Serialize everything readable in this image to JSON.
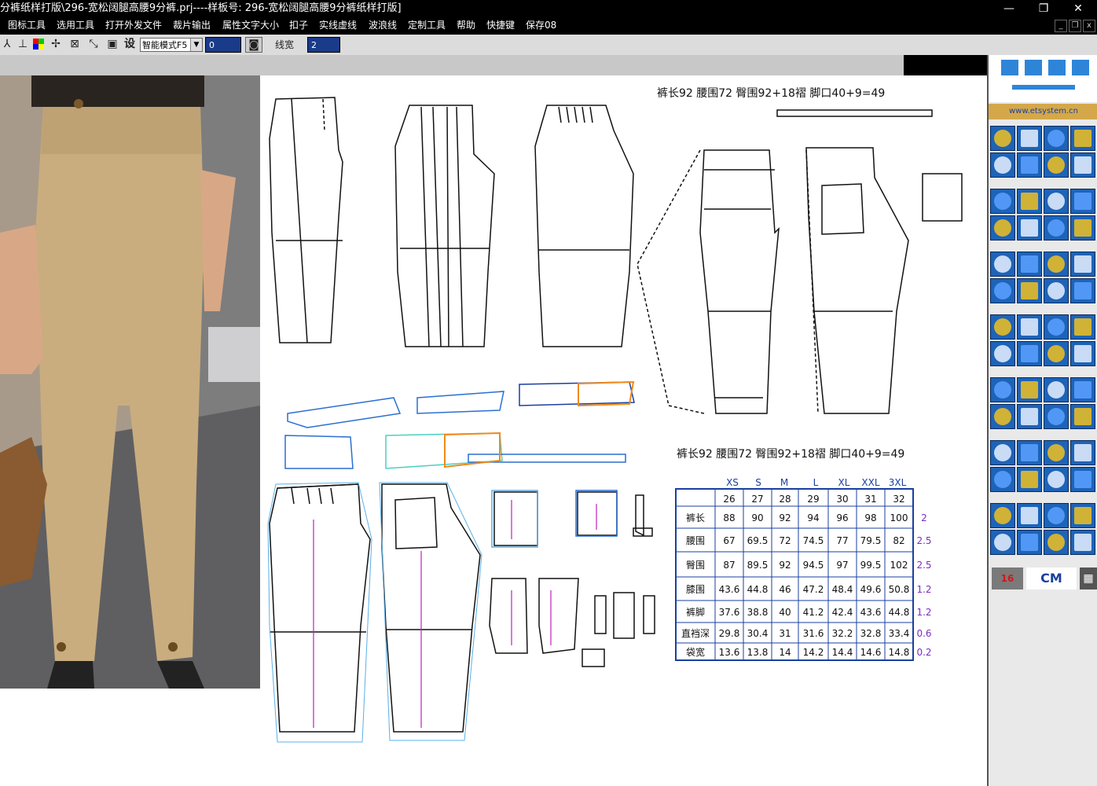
{
  "window": {
    "title": "分裤纸样打版\\296-宽松阔腿高腰9分裤.prj----样板号: 296-宽松阔腿高腰9分裤纸样打版]",
    "minimize": "—",
    "restore": "❐",
    "close": "✕"
  },
  "menu": [
    "图标工具",
    "选用工具",
    "打开外发文件",
    "裁片输出",
    "属性文字大小",
    "扣子",
    "实线虚线",
    "波浪线",
    "定制工具",
    "帮助",
    "快捷键",
    "保存08"
  ],
  "toolbar": {
    "she_label": "设",
    "mode_value": "智能模式F5",
    "num1": "0",
    "line_width_label": "线宽",
    "line_width_value": "2"
  },
  "sidebar": {
    "url": "www.etsystem.cn",
    "badge_16": "16",
    "unit_label": "CM"
  },
  "pattern": {
    "header_1": "裤长92   腰围72   臀围92+18褶   脚口40+9=49",
    "header_2": "裤长92   腰围72   臀围92+18褶   脚口40+9=49"
  },
  "size_table": {
    "sizes": [
      "XS",
      "S",
      "M",
      "L",
      "XL",
      "XXL",
      "3XL"
    ],
    "size_numbers": [
      "26",
      "27",
      "28",
      "29",
      "30",
      "31",
      "32"
    ],
    "rows": [
      {
        "label": "裤长",
        "values": [
          "88",
          "90",
          "92",
          "94",
          "96",
          "98",
          "100"
        ],
        "diff": "2"
      },
      {
        "label": "腰围",
        "values": [
          "67",
          "69.5",
          "72",
          "74.5",
          "77",
          "79.5",
          "82"
        ],
        "diff": "2.5"
      },
      {
        "label": "臀围",
        "values": [
          "87",
          "89.5",
          "92",
          "94.5",
          "97",
          "99.5",
          "102"
        ],
        "diff": "2.5"
      },
      {
        "label": "膝围",
        "values": [
          "43.6",
          "44.8",
          "46",
          "47.2",
          "48.4",
          "49.6",
          "50.8"
        ],
        "diff": "1.2"
      },
      {
        "label": "裤脚",
        "values": [
          "37.6",
          "38.8",
          "40",
          "41.2",
          "42.4",
          "43.6",
          "44.8"
        ],
        "diff": "1.2"
      },
      {
        "label": "直裆深",
        "values": [
          "29.8",
          "30.4",
          "31",
          "31.6",
          "32.2",
          "32.8",
          "33.4"
        ],
        "diff": "0.6"
      },
      {
        "label": "袋宽",
        "values": [
          "13.6",
          "13.8",
          "14",
          "14.2",
          "14.4",
          "14.6",
          "14.8"
        ],
        "diff": "0.2"
      }
    ]
  },
  "colors": {
    "accent_blue": "#1d63b8",
    "table_line": "#1a3fa0",
    "diff_purple": "#7a2fbf"
  }
}
